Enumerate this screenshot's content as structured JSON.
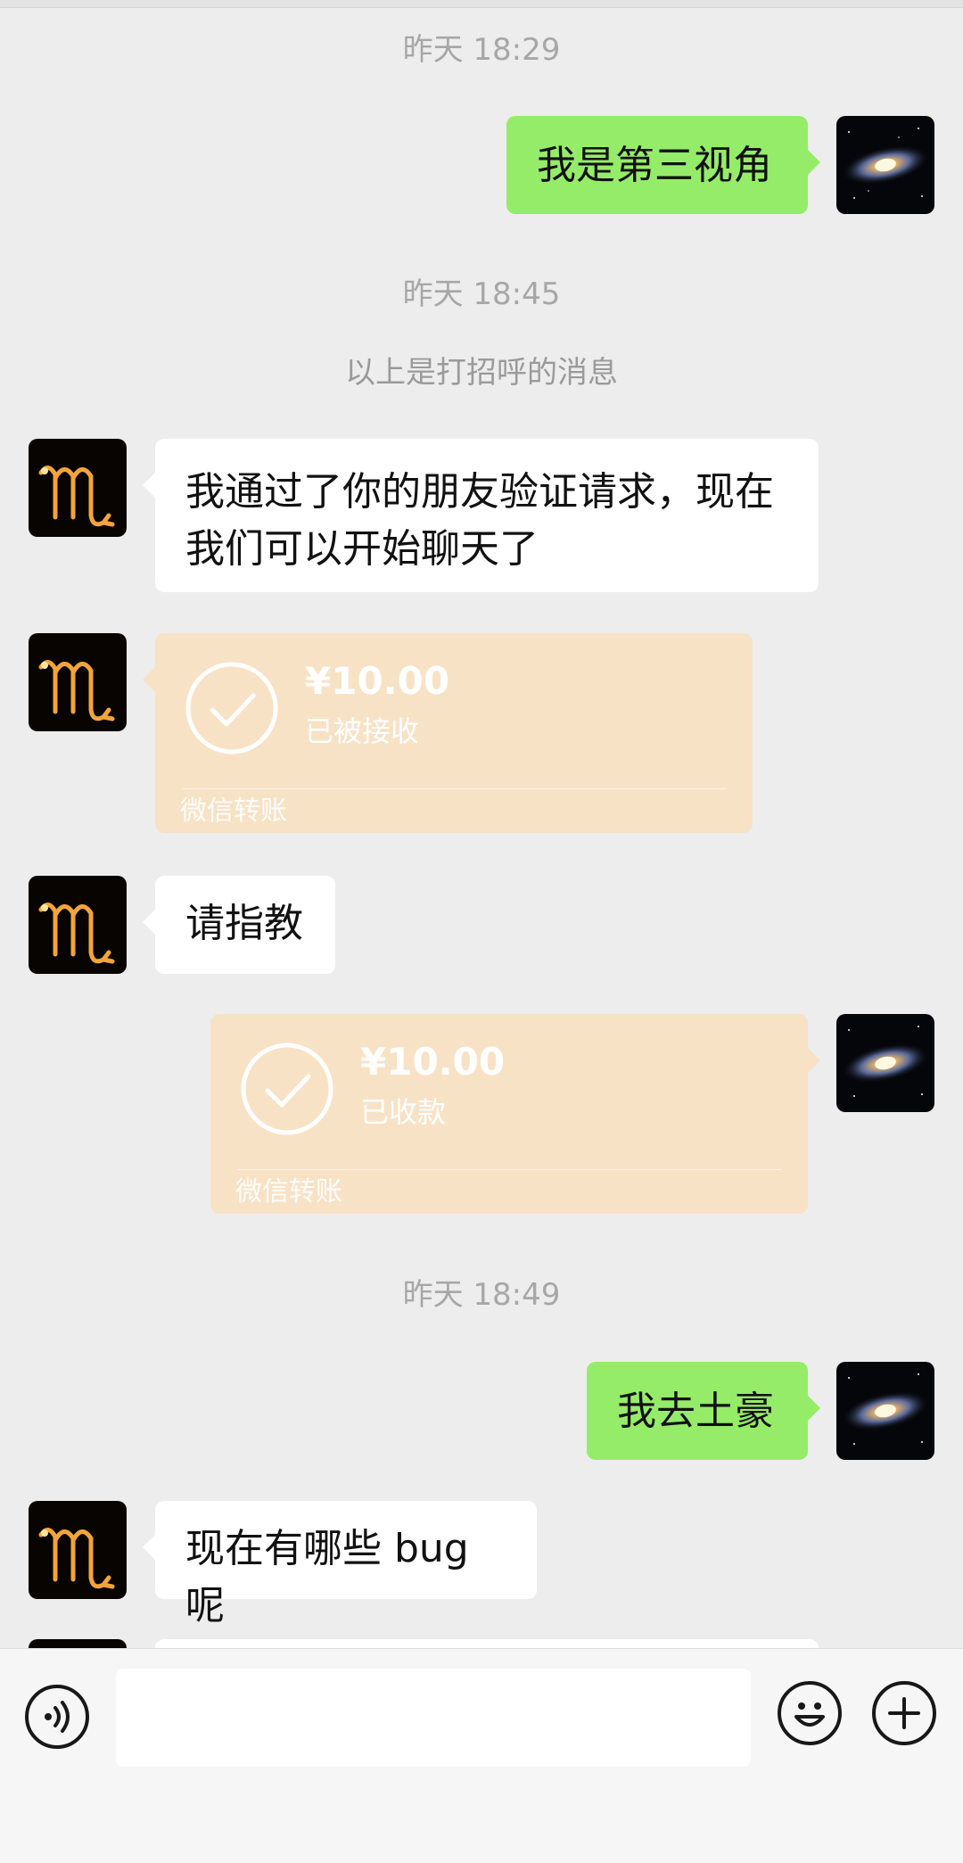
{
  "messages": {
    "ts1": "昨天 18:29",
    "m1": "我是第三视角",
    "ts2": "昨天 18:45",
    "system_notice": "以上是打招呼的消息",
    "m2_line1": "我通过了你的朋友验证请求，现在",
    "m2_line2": "我们可以开始聊天了",
    "t1": {
      "amount": "¥10.00",
      "status": "已被接收",
      "footer": "微信转账"
    },
    "m3": "请指教",
    "t2": {
      "amount": "¥10.00",
      "status": "已收款",
      "footer": "微信转账"
    },
    "ts3": "昨天 18:49",
    "m4": "我去土豪",
    "m5": "现在有哪些 bug呢"
  },
  "input_bar": {
    "voice_icon": "voice-icon",
    "emoji_icon": "emoji-icon",
    "plus_icon": "plus-icon",
    "text_value": ""
  },
  "colors": {
    "background": "#ededed",
    "self_bubble": "#95ec69",
    "other_bubble": "#ffffff",
    "transfer_card": "#f8e2c6",
    "timestamp": "#a7a7a7"
  }
}
